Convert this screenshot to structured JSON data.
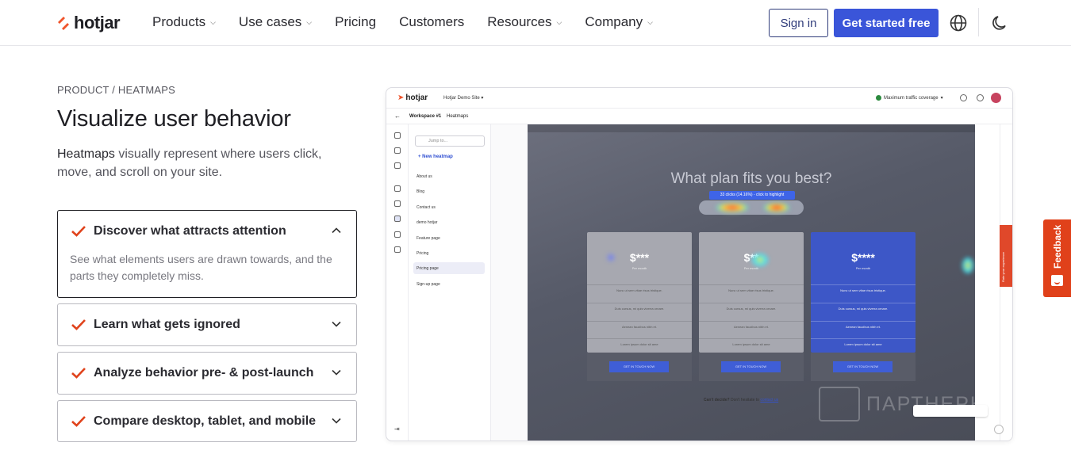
{
  "nav": {
    "logo": "hotjar",
    "links": [
      {
        "label": "Products",
        "has_menu": true
      },
      {
        "label": "Use cases",
        "has_menu": true
      },
      {
        "label": "Pricing",
        "has_menu": false
      },
      {
        "label": "Customers",
        "has_menu": false
      },
      {
        "label": "Resources",
        "has_menu": true
      },
      {
        "label": "Company",
        "has_menu": true
      }
    ],
    "signin": "Sign in",
    "get_started": "Get started free",
    "globe_icon": "globe-icon",
    "theme_icon": "moon-icon"
  },
  "hero": {
    "eyebrow": "PRODUCT / HEATMAPS",
    "title": "Visualize user behavior",
    "intro_bold": "Heatmaps",
    "intro_rest": " visually represent where users click, move, and scroll on your site."
  },
  "accordion": [
    {
      "title": "Discover what attracts attention",
      "open": true,
      "body": "See what elements users are drawn towards, and the parts they completely miss."
    },
    {
      "title": "Learn what gets ignored",
      "open": false
    },
    {
      "title": "Analyze behavior pre- & post-launch",
      "open": false
    },
    {
      "title": "Compare desktop, tablet, and mobile",
      "open": false
    }
  ],
  "mockup": {
    "logo": "hotjar",
    "site": "Hotjar Demo Site",
    "traffic": "Maximum traffic coverage",
    "workspace": "Workspace #1",
    "section": "Heatmaps",
    "jump_placeholder": "Jump to...",
    "new_heatmap": "+ New heatmap",
    "pages": [
      "About us",
      "Blog",
      "Contact us",
      "demo hotjar",
      "Feature page",
      "Pricing",
      "Pricing page",
      "Sign-up page"
    ],
    "active_page": "Pricing page",
    "canvas": {
      "headline": "What plan fits you best?",
      "tooltip": "33 clicks (14.16%) - click to highlight",
      "plans": [
        {
          "price": "$***",
          "per": "Per month"
        },
        {
          "price": "$**",
          "per": "Per month"
        },
        {
          "price": "$****",
          "per": "Per month"
        }
      ],
      "features": [
        "Nunc ut sem vitae risus tristique.",
        "Duis cursus, mi quis viverra ornare.",
        "Aenean faucibus nibh et.",
        "Lorem ipsum dolor sit ame"
      ],
      "cta": "GET IN TOUCH NOW",
      "footer_q": "Can't decide?",
      "footer_text": " Don't hesitate to ",
      "footer_link": "contact us"
    },
    "rate_label": "Rate your experience"
  },
  "feedback": "Feedback",
  "watermark": "ПАРТНЕРКИН",
  "colors": {
    "accent": "#3a55d9",
    "brand_orange": "#f0542b",
    "feedback": "#e0411a"
  }
}
